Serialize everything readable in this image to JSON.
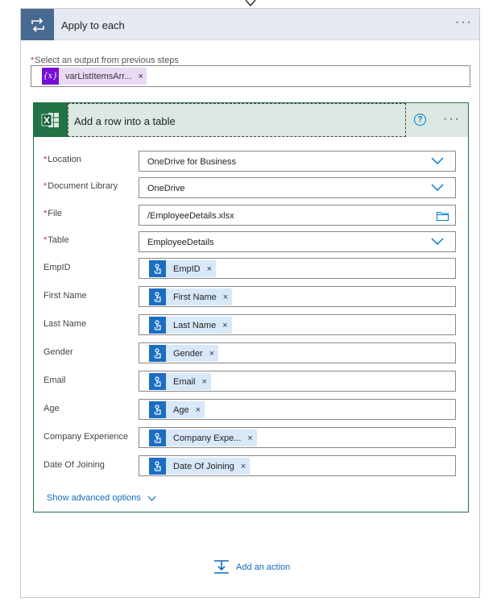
{
  "apply_to_each": {
    "title": "Apply to each",
    "select_label": "Select an output from previous steps",
    "variable_token": {
      "label": "varListItemsArr...",
      "icon": "variable-icon",
      "remove": "×"
    }
  },
  "action": {
    "title": "Add a row into a table",
    "help": "?",
    "required_fields": [
      {
        "label": "Location",
        "value": "OneDrive for Business"
      },
      {
        "label": "Document Library",
        "value": "OneDrive"
      },
      {
        "label": "File",
        "value": "/EmployeeDetails.xlsx"
      },
      {
        "label": "Table",
        "value": "EmployeeDetails"
      }
    ],
    "mapped_fields": [
      {
        "label": "EmpID",
        "token": "EmpID"
      },
      {
        "label": "First Name",
        "token": "First Name"
      },
      {
        "label": "Last Name",
        "token": "Last Name"
      },
      {
        "label": "Gender",
        "token": "Gender"
      },
      {
        "label": "Email",
        "token": "Email"
      },
      {
        "label": "Age",
        "token": "Age"
      },
      {
        "label": "Company Experience",
        "token": "Company Expe..."
      },
      {
        "label": "Date Of Joining",
        "token": "Date Of Joining"
      }
    ],
    "token_remove": "×",
    "show_advanced": "Show advanced options"
  },
  "add_action": {
    "label": "Add an action"
  },
  "required_marker": "*",
  "more_label": "···",
  "colors": {
    "loop_header": "#486991",
    "excel_green": "#217346",
    "variable_purple": "#770bd6",
    "token_blue": "#1b6ec2",
    "link_blue": "#0f6cbd"
  }
}
